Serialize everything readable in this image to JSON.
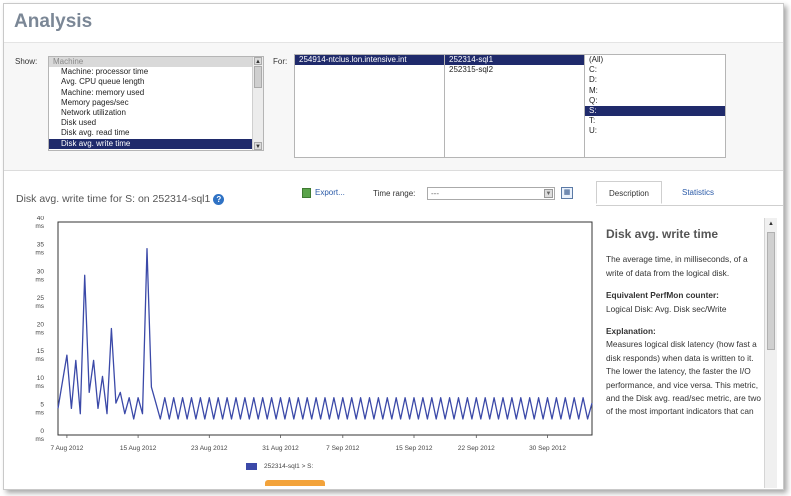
{
  "title": "Analysis",
  "filters": {
    "show_label": "Show:",
    "for_label": "For:",
    "metrics": [
      {
        "label": "Machine",
        "state": "header"
      },
      {
        "label": "Machine: processor time",
        "state": ""
      },
      {
        "label": "Avg. CPU queue length",
        "state": ""
      },
      {
        "label": "Machine: memory used",
        "state": ""
      },
      {
        "label": "Memory pages/sec",
        "state": ""
      },
      {
        "label": "Network utilization",
        "state": ""
      },
      {
        "label": "Disk used",
        "state": ""
      },
      {
        "label": "Disk avg. read time",
        "state": ""
      },
      {
        "label": "Disk avg. write time",
        "state": "selected"
      }
    ],
    "clusters": [
      {
        "label": "254914-ntclus.lon.intensive.int",
        "state": "selected"
      }
    ],
    "servers": [
      {
        "label": "252314-sql1",
        "state": "selected"
      },
      {
        "label": "252315-sql2",
        "state": ""
      }
    ],
    "drives": [
      {
        "label": "(All)",
        "state": ""
      },
      {
        "label": "C:",
        "state": ""
      },
      {
        "label": "D:",
        "state": ""
      },
      {
        "label": "M:",
        "state": ""
      },
      {
        "label": "Q:",
        "state": ""
      },
      {
        "label": "S:",
        "state": "selected"
      },
      {
        "label": "T:",
        "state": ""
      },
      {
        "label": "U:",
        "state": ""
      }
    ]
  },
  "panel": {
    "chart_title": "Disk avg. write time for S: on 252314-sql1",
    "export_label": "Export...",
    "time_range_label": "Time range:",
    "time_range_value": "---",
    "icons": {
      "help": "help-icon",
      "export": "export-icon",
      "calendar": "calendar-icon",
      "dropdown": "chevron-down-icon"
    }
  },
  "chart_data": {
    "type": "line",
    "title": "Disk avg. write time for S: on 252314-sql1",
    "xlabel": "",
    "ylabel": "",
    "ylim": [
      0,
      40
    ],
    "y_ticks": [
      0,
      5,
      10,
      15,
      20,
      25,
      30,
      35,
      40
    ],
    "y_tick_labels": [
      "0 ms",
      "5 ms",
      "10 ms",
      "15 ms",
      "20 ms",
      "25 ms",
      "30 ms",
      "35 ms",
      "40 ms"
    ],
    "x_range": [
      "2012-08-06",
      "2012-10-05"
    ],
    "x_tick_dates": [
      "2012-08-07",
      "2012-08-15",
      "2012-08-23",
      "2012-08-31",
      "2012-09-07",
      "2012-09-15",
      "2012-09-22",
      "2012-09-30"
    ],
    "x_tick_labels": [
      "7 Aug 2012",
      "15 Aug 2012",
      "23 Aug 2012",
      "31 Aug 2012",
      "7 Sep 2012",
      "15 Sep 2012",
      "22 Sep 2012",
      "30 Sep 2012"
    ],
    "grid": false,
    "legend": "bottom",
    "color": "#3b49a8",
    "series": [
      {
        "name": "252314-sql1 > S:",
        "points": [
          [
            "2012-08-06",
            5
          ],
          [
            "2012-08-07",
            15
          ],
          [
            "2012-08-07",
            5
          ],
          [
            "2012-08-08",
            14
          ],
          [
            "2012-08-08",
            4
          ],
          [
            "2012-08-09",
            30
          ],
          [
            "2012-08-09",
            8
          ],
          [
            "2012-08-10",
            14
          ],
          [
            "2012-08-10",
            5
          ],
          [
            "2012-08-11",
            11
          ],
          [
            "2012-08-11",
            4
          ],
          [
            "2012-08-12",
            20
          ],
          [
            "2012-08-12",
            6
          ],
          [
            "2012-08-13",
            8
          ],
          [
            "2012-08-13",
            4
          ],
          [
            "2012-08-14",
            7
          ],
          [
            "2012-08-14",
            3
          ],
          [
            "2012-08-15",
            7
          ],
          [
            "2012-08-15",
            4
          ],
          [
            "2012-08-16",
            35
          ],
          [
            "2012-08-16",
            9
          ],
          [
            "2012-08-17",
            6
          ],
          [
            "2012-08-17",
            3
          ],
          [
            "2012-08-18",
            7
          ],
          [
            "2012-08-18",
            3
          ],
          [
            "2012-08-19",
            7
          ],
          [
            "2012-08-19",
            3
          ],
          [
            "2012-08-20",
            7
          ],
          [
            "2012-08-20",
            3
          ],
          [
            "2012-08-21",
            7
          ],
          [
            "2012-08-21",
            3
          ],
          [
            "2012-08-22",
            7
          ],
          [
            "2012-08-22",
            3
          ],
          [
            "2012-08-23",
            7
          ],
          [
            "2012-08-23",
            3
          ],
          [
            "2012-08-24",
            7
          ],
          [
            "2012-08-24",
            3
          ],
          [
            "2012-08-25",
            7
          ],
          [
            "2012-08-25",
            3
          ],
          [
            "2012-08-26",
            7
          ],
          [
            "2012-08-26",
            3
          ],
          [
            "2012-08-27",
            7
          ],
          [
            "2012-08-27",
            3
          ],
          [
            "2012-08-28",
            7
          ],
          [
            "2012-08-28",
            3
          ],
          [
            "2012-08-29",
            7
          ],
          [
            "2012-08-29",
            3
          ],
          [
            "2012-08-30",
            7
          ],
          [
            "2012-08-30",
            3
          ],
          [
            "2012-08-31",
            7
          ],
          [
            "2012-08-31",
            3
          ],
          [
            "2012-09-01",
            7
          ],
          [
            "2012-09-01",
            3
          ],
          [
            "2012-09-02",
            7
          ],
          [
            "2012-09-02",
            3
          ],
          [
            "2012-09-03",
            7
          ],
          [
            "2012-09-03",
            3
          ],
          [
            "2012-09-04",
            7
          ],
          [
            "2012-09-04",
            3
          ],
          [
            "2012-09-05",
            7
          ],
          [
            "2012-09-05",
            3
          ],
          [
            "2012-09-06",
            7
          ],
          [
            "2012-09-06",
            3
          ],
          [
            "2012-09-07",
            7
          ],
          [
            "2012-09-07",
            3
          ],
          [
            "2012-09-08",
            7
          ],
          [
            "2012-09-08",
            3
          ],
          [
            "2012-09-09",
            7
          ],
          [
            "2012-09-09",
            3
          ],
          [
            "2012-09-10",
            7
          ],
          [
            "2012-09-10",
            3
          ],
          [
            "2012-09-11",
            7
          ],
          [
            "2012-09-11",
            3
          ],
          [
            "2012-09-12",
            7
          ],
          [
            "2012-09-12",
            3
          ],
          [
            "2012-09-13",
            7
          ],
          [
            "2012-09-13",
            3
          ],
          [
            "2012-09-14",
            7
          ],
          [
            "2012-09-14",
            3
          ],
          [
            "2012-09-15",
            7
          ],
          [
            "2012-09-15",
            3
          ],
          [
            "2012-09-16",
            7
          ],
          [
            "2012-09-16",
            3
          ],
          [
            "2012-09-17",
            7
          ],
          [
            "2012-09-17",
            3
          ],
          [
            "2012-09-18",
            7
          ],
          [
            "2012-09-18",
            3
          ],
          [
            "2012-09-19",
            7
          ],
          [
            "2012-09-19",
            3
          ],
          [
            "2012-09-20",
            7
          ],
          [
            "2012-09-20",
            3
          ],
          [
            "2012-09-21",
            7
          ],
          [
            "2012-09-21",
            3
          ],
          [
            "2012-09-22",
            7
          ],
          [
            "2012-09-22",
            3
          ],
          [
            "2012-09-23",
            7
          ],
          [
            "2012-09-23",
            3
          ],
          [
            "2012-09-24",
            7
          ],
          [
            "2012-09-24",
            3
          ],
          [
            "2012-09-25",
            7
          ],
          [
            "2012-09-25",
            3
          ],
          [
            "2012-09-26",
            7
          ],
          [
            "2012-09-26",
            3
          ],
          [
            "2012-09-27",
            7
          ],
          [
            "2012-09-27",
            3
          ],
          [
            "2012-09-28",
            7
          ],
          [
            "2012-09-28",
            3
          ],
          [
            "2012-09-29",
            7
          ],
          [
            "2012-09-29",
            3
          ],
          [
            "2012-09-30",
            7
          ],
          [
            "2012-09-30",
            3
          ],
          [
            "2012-10-01",
            7
          ],
          [
            "2012-10-01",
            3
          ],
          [
            "2012-10-02",
            7
          ],
          [
            "2012-10-02",
            3
          ],
          [
            "2012-10-03",
            7
          ],
          [
            "2012-10-03",
            3
          ],
          [
            "2012-10-04",
            7
          ],
          [
            "2012-10-04",
            3
          ],
          [
            "2012-10-05",
            6
          ]
        ]
      }
    ]
  },
  "description": {
    "tabs": [
      "Description",
      "Statistics"
    ],
    "heading": "Disk avg. write time",
    "intro": "The average time, in milliseconds, of a write of data from the logical disk.",
    "counter_label": "Equivalent PerfMon counter:",
    "counter_value": "Logical Disk: Avg. Disk sec/Write",
    "explanation_label": "Explanation:",
    "explanation_text": "Measures logical disk latency (how fast a disk responds) when data is written to it. The lower the latency, the faster the I/O performance, and vice versa. This metric, and the Disk avg. read/sec metric, are two of the most important indicators that can"
  }
}
